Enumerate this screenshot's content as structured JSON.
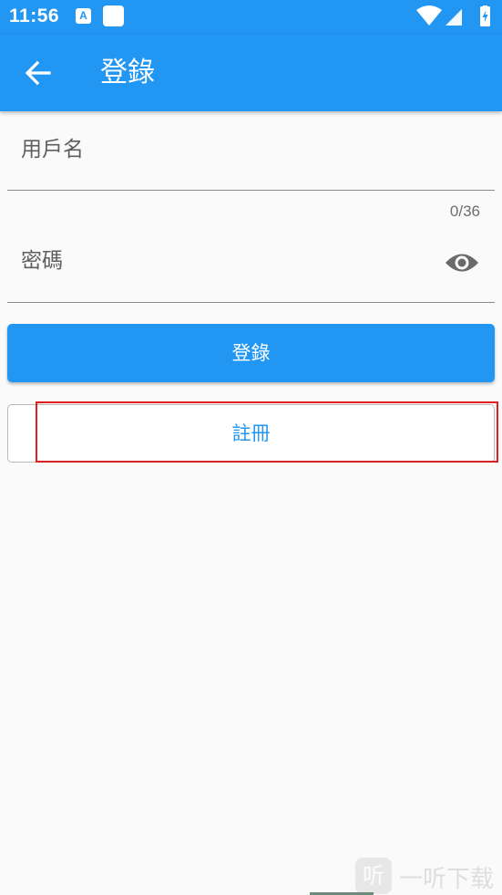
{
  "status_bar": {
    "time": "11:56",
    "notif_icon_letter": "A",
    "icons": [
      "wifi-icon",
      "signal-icon",
      "battery-charging-icon"
    ]
  },
  "app_bar": {
    "title": "登錄",
    "back_icon": "arrow-left-icon"
  },
  "form": {
    "username_label": "用戶名",
    "username_counter": "0/36",
    "password_label": "密碼",
    "password_toggle_icon": "eye-icon"
  },
  "buttons": {
    "login_label": "登錄",
    "register_label": "註冊"
  },
  "watermark": {
    "logo_char": "听",
    "text": "一听下载"
  },
  "colors": {
    "primary": "#2196f3",
    "background": "#fafafa",
    "highlight": "#e02020"
  }
}
